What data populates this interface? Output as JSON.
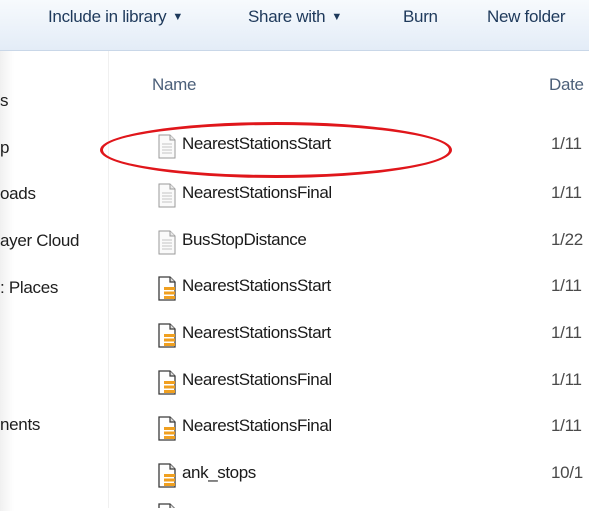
{
  "toolbar": {
    "include_in_library": "Include in library",
    "share_with": "Share with",
    "burn": "Burn",
    "new_folder": "New folder"
  },
  "nav": {
    "items": [
      {
        "label": "s"
      },
      {
        "label": "p"
      },
      {
        "label": "oads"
      },
      {
        "label": "ayer Cloud"
      },
      {
        "label": ": Places"
      },
      {
        "label": "nents"
      }
    ]
  },
  "columns": {
    "name": "Name",
    "date": "Date"
  },
  "files": [
    {
      "name": "NearestStationsStart",
      "date": "1/11",
      "icon": "document-icon"
    },
    {
      "name": "NearestStationsFinal",
      "date": "1/11",
      "icon": "document-icon"
    },
    {
      "name": "BusStopDistance",
      "date": "1/22",
      "icon": "document-icon"
    },
    {
      "name": "NearestStationsStart",
      "date": "1/11",
      "icon": "database-document-icon"
    },
    {
      "name": "NearestStationsStart",
      "date": "1/11",
      "icon": "database-document-icon"
    },
    {
      "name": "NearestStationsFinal",
      "date": "1/11",
      "icon": "database-document-icon"
    },
    {
      "name": "NearestStationsFinal",
      "date": "1/11",
      "icon": "database-document-icon"
    },
    {
      "name": "ank_stops",
      "date": "10/1",
      "icon": "database-document-icon"
    }
  ],
  "annotation": {
    "color": "#e0161b",
    "highlighted_file": "NearestStationsStart"
  }
}
